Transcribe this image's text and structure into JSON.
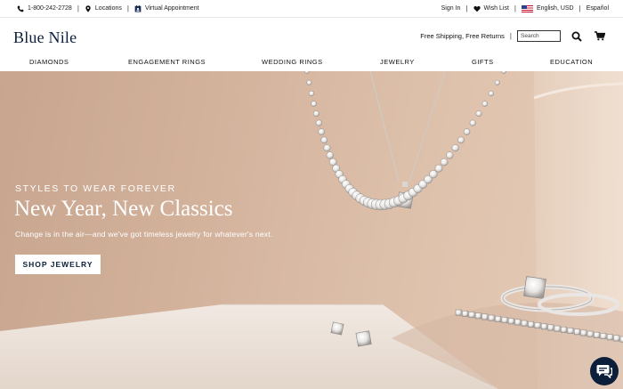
{
  "utility_left": {
    "phone": "1-800-242-2728",
    "locations": "Locations",
    "virtual": "Virtual Appointment"
  },
  "utility_right": {
    "signin": "Sign In",
    "wishlist": "Wish List",
    "locale": "English, USD",
    "espanol": "Español"
  },
  "header": {
    "logo": "Blue Nile",
    "shipping": "Free Shipping, Free Returns",
    "search_placeholder": "Search"
  },
  "nav": [
    "DIAMONDS",
    "ENGAGEMENT RINGS",
    "WEDDING RINGS",
    "JEWELRY",
    "GIFTS",
    "EDUCATION"
  ],
  "hero": {
    "eyebrow": "STYLES TO WEAR FOREVER",
    "headline": "New Year, New Classics",
    "subtext": "Change is in the air—and we've got timeless jewelry for whatever's next.",
    "cta": "SHOP JEWELRY"
  },
  "colors": {
    "brand_navy": "#0b1f3a",
    "hero_background": "#d4b39d"
  },
  "icons": [
    "phone-icon",
    "location-pin-icon",
    "video-calendar-icon",
    "heart-icon",
    "us-flag-icon",
    "search-icon",
    "cart-icon",
    "chat-icon"
  ]
}
